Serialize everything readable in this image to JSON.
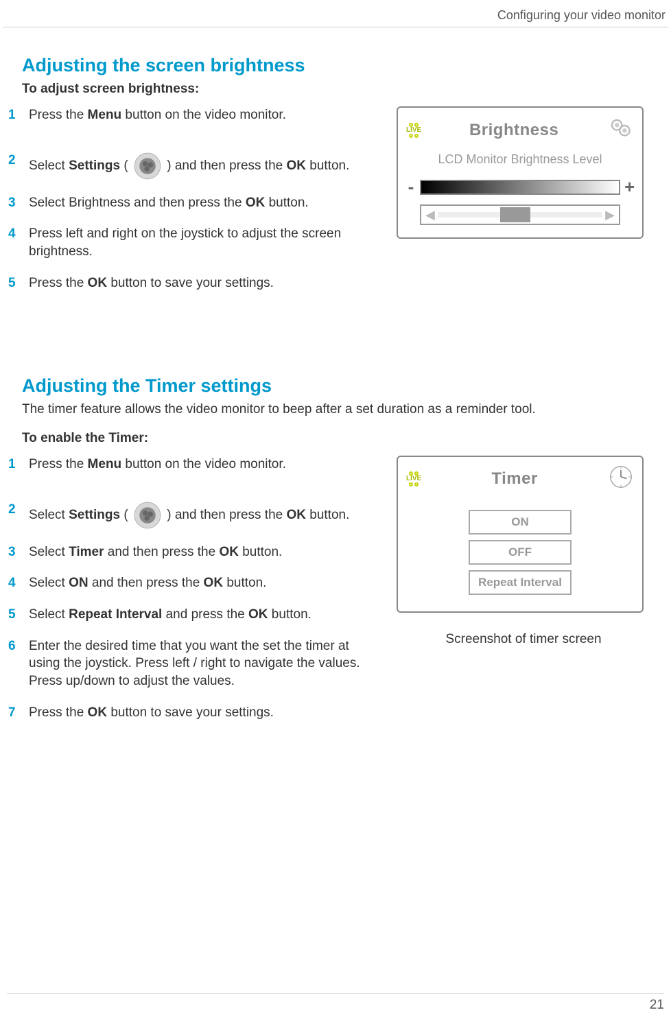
{
  "header": {
    "section": "Configuring your video monitor"
  },
  "footer": {
    "page_number": "21"
  },
  "section1": {
    "title": "Adjusting the screen brightness",
    "subtitle": "To adjust screen brightness:",
    "steps": {
      "s1_a": "Press the ",
      "s1_b": "Menu",
      "s1_c": " button on the video monitor.",
      "s2_a": "Select ",
      "s2_b": "Settings",
      "s2_c": " (",
      "s2_d": ") and then press the ",
      "s2_e": "OK",
      "s2_f": " button.",
      "s3_a": "Select Brightness and then press the ",
      "s3_b": "OK",
      "s3_c": " button.",
      "s4": "Press left and right on the joystick to adjust the screen brightness.",
      "s5_a": "Press the ",
      "s5_b": "OK",
      "s5_c": " button to save your settings."
    },
    "screenshot": {
      "live": "LIVE",
      "title": "Brightness",
      "subtitle": "LCD Monitor Brightness Level",
      "minus": "-",
      "plus": "+"
    }
  },
  "section2": {
    "title": "Adjusting the Timer settings",
    "intro": "The timer feature allows the video monitor to beep after a set duration as a reminder tool.",
    "subtitle": "To enable the Timer:",
    "steps": {
      "s1_a": "Press the ",
      "s1_b": "Menu",
      "s1_c": " button on the video monitor.",
      "s2_a": "Select ",
      "s2_b": "Settings",
      "s2_c": " (",
      "s2_d": ") and then press the ",
      "s2_e": "OK",
      "s2_f": " button.",
      "s3_a": "Select ",
      "s3_b": "Timer",
      "s3_c": " and then press the ",
      "s3_d": "OK",
      "s3_e": " button.",
      "s4_a": "Select ",
      "s4_b": "ON",
      "s4_c": " and then press the ",
      "s4_d": "OK",
      "s4_e": " button.",
      "s5_a": "Select ",
      "s5_b": "Repeat Interval",
      "s5_c": " and press the ",
      "s5_d": "OK",
      "s5_e": " button.",
      "s6": "Enter the desired time that you want the set the timer at using the joystick. Press left / right to navigate the values. Press up/down to adjust the values.",
      "s7_a": "Press the ",
      "s7_b": "OK",
      "s7_c": " button to save your settings."
    },
    "screenshot": {
      "live": "LIVE",
      "title": "Timer",
      "on": "ON",
      "off": "OFF",
      "repeat": "Repeat Interval"
    },
    "caption": "Screenshot of timer screen"
  }
}
